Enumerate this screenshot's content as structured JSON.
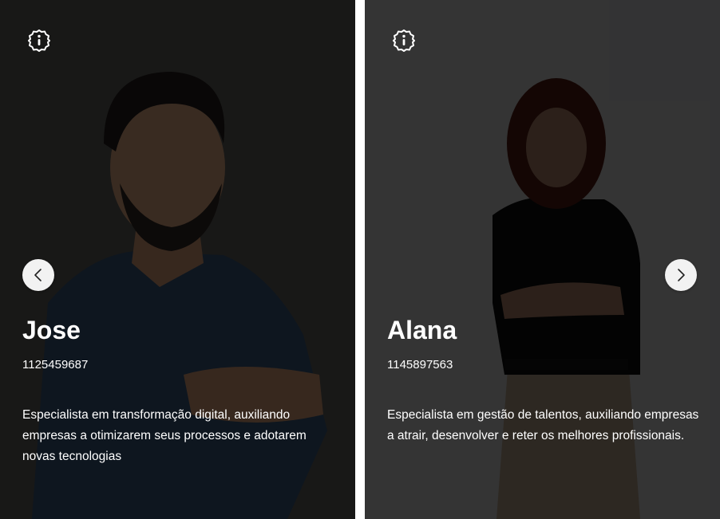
{
  "carousel": {
    "prev_icon": "chevron-left-icon",
    "next_icon": "chevron-right-icon",
    "cards": [
      {
        "name": "Jose",
        "phone": "1125459687",
        "description": "Especialista em transformação digital, auxiliando empresas a otimizarem seus processos e adotarem novas tecnologias",
        "info_icon": "info-badge-icon"
      },
      {
        "name": "Alana",
        "phone": "1145897563",
        "description": "Especialista em gestão de talentos, auxiliando empresas a atrair, desenvolver e reter os melhores profissionais.",
        "info_icon": "info-badge-icon"
      }
    ]
  },
  "colors": {
    "text": "#ffffff",
    "nav_button": "#f2f2f2",
    "divider": "#ffffff"
  }
}
